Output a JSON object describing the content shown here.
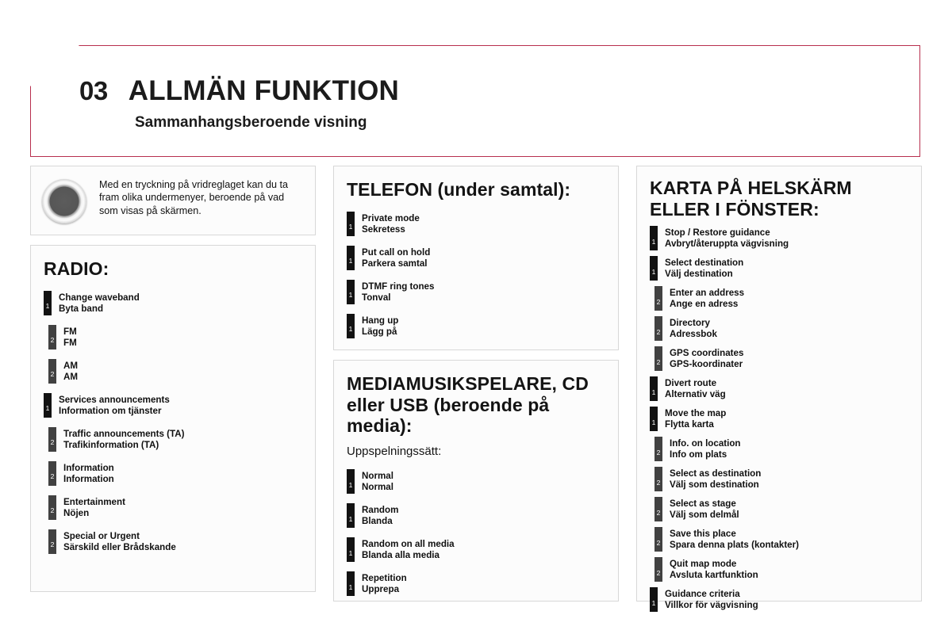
{
  "header": {
    "chapter_number": "03",
    "chapter_title": "ALLMÄN FUNKTION",
    "subtitle": "Sammanhangsberoende visning",
    "accent_color": "#B82F4E"
  },
  "knob_note": {
    "icon": "rotary-knob-icon",
    "text": "Med en tryckning på vridreglaget kan du ta fram olika undermenyer, beroende på vad som visas på skärmen."
  },
  "radio": {
    "title": "RADIO:",
    "items": [
      {
        "level": 1,
        "num": "1",
        "en": "Change waveband",
        "sv": "Byta band"
      },
      {
        "level": 2,
        "num": "2",
        "en": "FM",
        "sv": "FM"
      },
      {
        "level": 2,
        "num": "2",
        "en": "AM",
        "sv": "AM"
      },
      {
        "level": 1,
        "num": "1",
        "en": "Services announcements",
        "sv": "Information om tjänster"
      },
      {
        "level": 2,
        "num": "2",
        "en": "Traffic announcements (TA)",
        "sv": "Trafikinformation (TA)"
      },
      {
        "level": 2,
        "num": "2",
        "en": "Information",
        "sv": "Information"
      },
      {
        "level": 2,
        "num": "2",
        "en": "Entertainment",
        "sv": "Nöjen"
      },
      {
        "level": 2,
        "num": "2",
        "en": "Special or Urgent",
        "sv": "Särskild eller Brådskande"
      }
    ]
  },
  "telephone": {
    "title": "TELEFON (under samtal):",
    "items": [
      {
        "level": 1,
        "num": "1",
        "en": "Private mode",
        "sv": "Sekretess"
      },
      {
        "level": 1,
        "num": "1",
        "en": "Put call on hold",
        "sv": "Parkera samtal"
      },
      {
        "level": 1,
        "num": "1",
        "en": "DTMF ring tones",
        "sv": "Tonval"
      },
      {
        "level": 1,
        "num": "1",
        "en": "Hang up",
        "sv": "Lägg på"
      }
    ]
  },
  "media": {
    "title": "MEDIAMUSIKSPELARE, CD eller USB (beroende på media):",
    "subtitle": "Uppspelningssätt:",
    "items": [
      {
        "level": 1,
        "num": "1",
        "en": "Normal",
        "sv": "Normal"
      },
      {
        "level": 1,
        "num": "1",
        "en": "Random",
        "sv": "Blanda"
      },
      {
        "level": 1,
        "num": "1",
        "en": "Random on all media",
        "sv": "Blanda alla media"
      },
      {
        "level": 1,
        "num": "1",
        "en": "Repetition",
        "sv": "Upprepa"
      }
    ]
  },
  "map": {
    "title": "KARTA PÅ HELSKÄRM ELLER I FÖNSTER:",
    "items": [
      {
        "level": 1,
        "num": "1",
        "en": "Stop / Restore guidance",
        "sv": "Avbryt/återuppta vägvisning"
      },
      {
        "level": 1,
        "num": "1",
        "en": "Select destination",
        "sv": "Välj destination"
      },
      {
        "level": 2,
        "num": "2",
        "en": "Enter an address",
        "sv": "Ange en adress"
      },
      {
        "level": 2,
        "num": "2",
        "en": "Directory",
        "sv": "Adressbok"
      },
      {
        "level": 2,
        "num": "2",
        "en": "GPS coordinates",
        "sv": "GPS-koordinater"
      },
      {
        "level": 1,
        "num": "1",
        "en": "Divert route",
        "sv": "Alternativ väg"
      },
      {
        "level": 1,
        "num": "1",
        "en": "Move the map",
        "sv": "Flytta karta"
      },
      {
        "level": 2,
        "num": "2",
        "en": "Info. on location",
        "sv": "Info om plats"
      },
      {
        "level": 2,
        "num": "2",
        "en": "Select as destination",
        "sv": "Välj som destination"
      },
      {
        "level": 2,
        "num": "2",
        "en": "Select as stage",
        "sv": "Välj som delmål"
      },
      {
        "level": 2,
        "num": "2",
        "en": "Save this place",
        "sv": "Spara denna plats (kontakter)"
      },
      {
        "level": 2,
        "num": "2",
        "en": "Quit map mode",
        "sv": "Avsluta kartfunktion"
      },
      {
        "level": 1,
        "num": "1",
        "en": "Guidance criteria",
        "sv": "Villkor för vägvisning"
      }
    ]
  }
}
